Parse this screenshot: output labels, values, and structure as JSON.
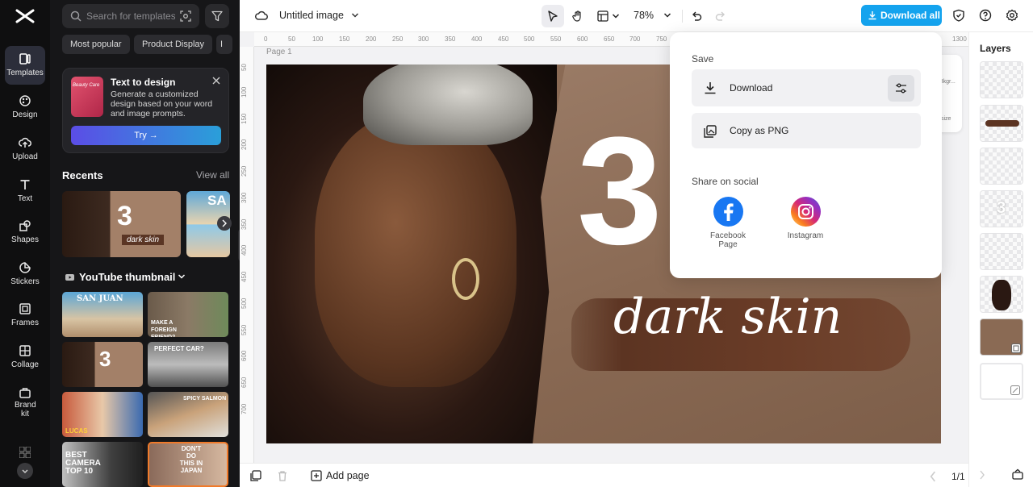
{
  "rail": {
    "items": [
      {
        "label": "Templates"
      },
      {
        "label": "Design"
      },
      {
        "label": "Upload"
      },
      {
        "label": "Text"
      },
      {
        "label": "Shapes"
      },
      {
        "label": "Stickers"
      },
      {
        "label": "Frames"
      },
      {
        "label": "Collage"
      },
      {
        "label": "Brand kit"
      }
    ]
  },
  "panel": {
    "search_placeholder": "Search for templates",
    "chips": [
      "Most popular",
      "Product Display",
      "I"
    ],
    "promo": {
      "thumb_text": "Beauty Care",
      "title": "Text to design",
      "description": "Generate a customized design based on your word and image prompts.",
      "cta": "Try →"
    },
    "recents_title": "Recents",
    "view_all": "View all",
    "recent1": {
      "number": "3",
      "script": "dark skin"
    },
    "recent2": {
      "text": "SA"
    },
    "youtube_title": "YouTube thumbnail",
    "tiles": [
      {
        "text": "SAN JUAN"
      },
      {
        "text": "MAKE A FOREIGN FRIEND?"
      },
      {
        "text": "3"
      },
      {
        "text": "PERFECT CAR?"
      },
      {
        "text": "LUCAS"
      },
      {
        "text": "SPICY SALMON"
      },
      {
        "text": "BEST CAMERA TOP 10"
      },
      {
        "text": "DON'T DO THIS IN JAPAN"
      }
    ]
  },
  "topbar": {
    "title": "Untitled image",
    "zoom": "78%",
    "download_all": "Download all"
  },
  "ruler": {
    "h_ticks": [
      "0",
      "50",
      "100",
      "150",
      "200",
      "250",
      "300",
      "350",
      "400",
      "450",
      "500",
      "550",
      "600",
      "650",
      "700",
      "750",
      "1300"
    ],
    "v_ticks": [
      "50",
      "100",
      "150",
      "200",
      "250",
      "300",
      "350",
      "400",
      "450",
      "500",
      "550",
      "600",
      "650",
      "700"
    ]
  },
  "canvas": {
    "page_label": "Page 1",
    "big_number": "3",
    "script_text": "dark skin"
  },
  "side_tool": {
    "t1": "Bkgr...",
    "t2": "size"
  },
  "popover": {
    "save_label": "Save",
    "download_label": "Download",
    "copy_label": "Copy as PNG",
    "share_label": "Share on social",
    "facebook_label": "Facebook Page",
    "instagram_label": "Instagram"
  },
  "layers": {
    "title": "Layers"
  },
  "bottombar": {
    "add_page": "Add page",
    "pages": "1/1"
  }
}
